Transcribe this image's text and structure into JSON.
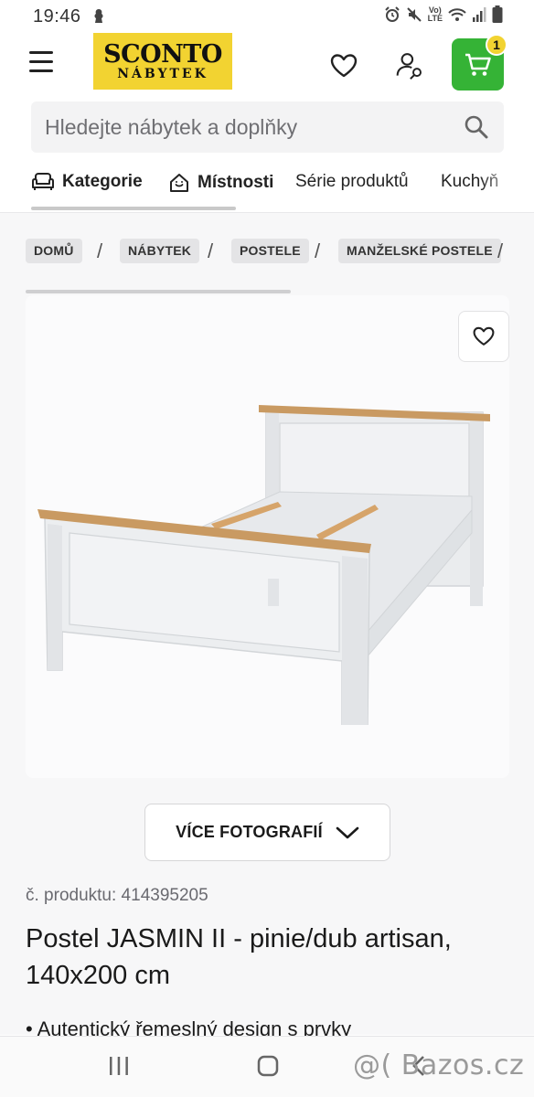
{
  "status_bar": {
    "time": "19:46",
    "network_label_top": "Vo)",
    "network_label_bottom": "LTE"
  },
  "header": {
    "logo_main": "SCONTO",
    "logo_sub": "NÁBYTEK",
    "cart_count": "1",
    "brand_colors": {
      "yellow": "#f2d331",
      "green": "#35b336"
    }
  },
  "search": {
    "placeholder": "Hledejte nábytek a doplňky"
  },
  "nav": {
    "tabs": [
      {
        "label": "Kategorie",
        "icon": "armchair-icon"
      },
      {
        "label": "Místnosti",
        "icon": "house-icon"
      },
      {
        "label": "Série produktů"
      },
      {
        "label": "Kuchyň"
      }
    ]
  },
  "breadcrumb": {
    "items": [
      "DOMŮ",
      "NÁBYTEK",
      "POSTELE",
      "MANŽELSKÉ POSTELE"
    ],
    "separator": "/"
  },
  "product": {
    "more_photos_label": "VÍCE FOTOGRAFIÍ",
    "product_number": "č. produktu: 414395205",
    "title": "Postel JASMIN II - pinie/dub artisan, 140x200 cm",
    "bullet_text": "• Autentický řemeslný design s prvky"
  },
  "bottom_nav": {
    "watermark": "@( Bazos.cz"
  }
}
